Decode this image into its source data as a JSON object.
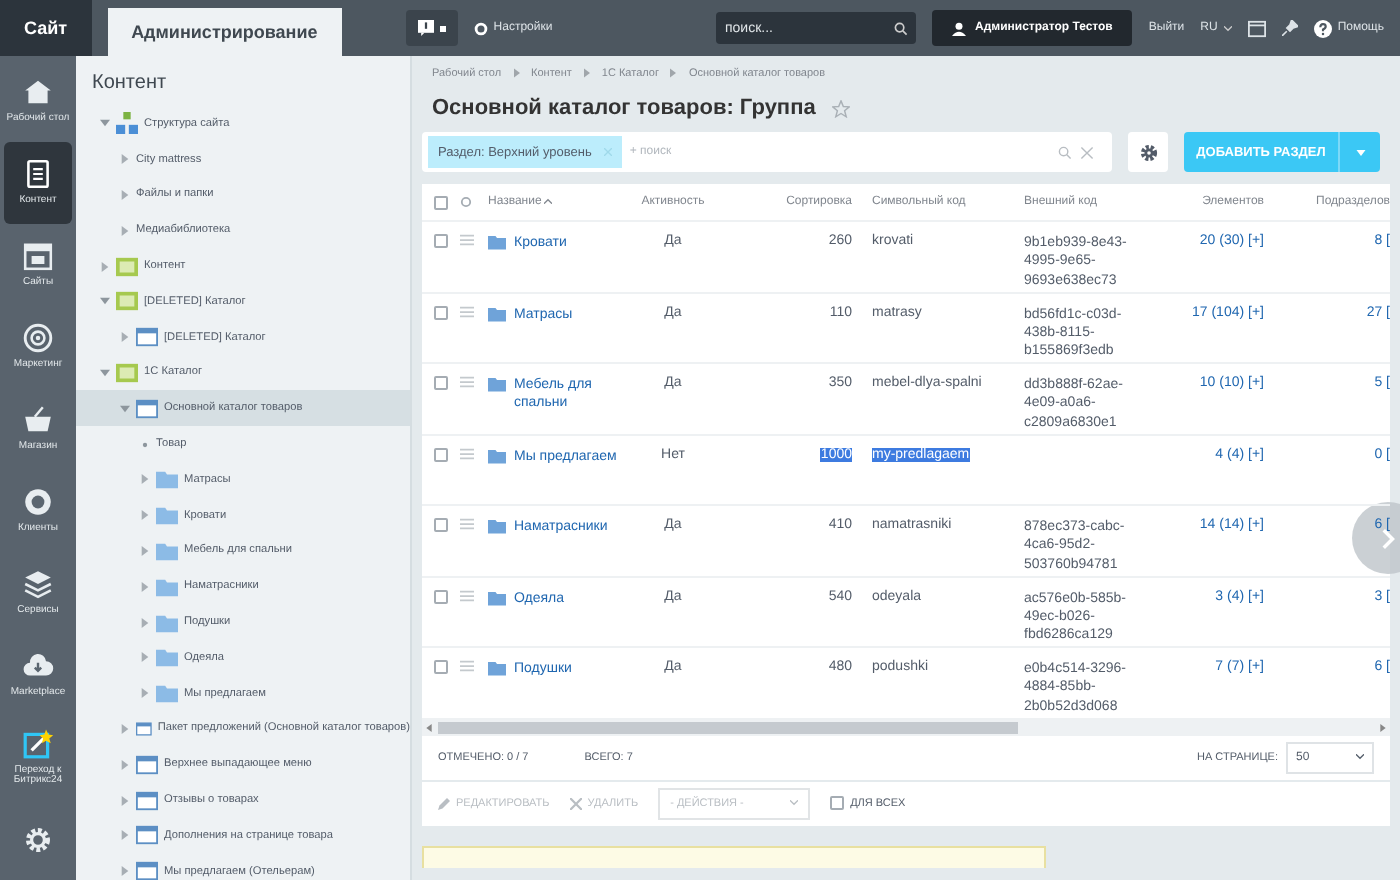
{
  "topbar": {
    "tabs": [
      {
        "label": "Сайт",
        "selected": false
      },
      {
        "label": "Администрирование",
        "selected": true
      }
    ],
    "settings": "Настройки",
    "search": {
      "placeholder": "поиск..."
    },
    "user": "Администратор Тестов",
    "logout": "Выйти",
    "language": "RU",
    "help": "Помощь"
  },
  "rail": [
    {
      "label": "Рабочий стол",
      "kind": "home",
      "selected": false
    },
    {
      "label": "Контент",
      "kind": "document",
      "selected": true
    },
    {
      "label": "Сайты",
      "kind": "calendar",
      "selected": false
    },
    {
      "label": "Маркетинг",
      "kind": "target",
      "selected": false
    },
    {
      "label": "Магазин",
      "kind": "basket",
      "selected": false
    },
    {
      "label": "Клиенты",
      "kind": "clients",
      "selected": false
    },
    {
      "label": "Сервисы",
      "kind": "layers",
      "selected": false
    },
    {
      "label": "Marketplace",
      "kind": "cloud",
      "selected": false
    },
    {
      "label": "Переход к Битрикс24",
      "kind": "wand",
      "selected": false
    },
    {
      "kind": "gear",
      "selected": false
    }
  ],
  "sidebar": {
    "title": "Контент",
    "items": [
      {
        "label": "Структура сайта",
        "kind": "site",
        "expanded": true,
        "selected": false,
        "children": [
          {
            "label": "City mattress",
            "kind": "plain",
            "expanded": false,
            "selected": false
          },
          {
            "label": "Файлы и папки",
            "kind": "plain",
            "expanded": false,
            "selected": false
          },
          {
            "label": "Медиабиблиотека",
            "kind": "plain",
            "expanded": false,
            "selected": false
          }
        ]
      },
      {
        "label": "Контент",
        "kind": "type",
        "expanded": false,
        "selected": false
      },
      {
        "label": "[DELETED] Каталог",
        "kind": "type",
        "expanded": true,
        "selected": false,
        "children": [
          {
            "label": "[DELETED] Каталог",
            "kind": "block",
            "expanded": false,
            "selected": false
          }
        ]
      },
      {
        "label": "1С Каталог",
        "kind": "type",
        "expanded": true,
        "selected": false,
        "children": [
          {
            "label": "Основной каталог товаров",
            "kind": "block",
            "expanded": true,
            "selected": true,
            "children": [
              {
                "label": "Товар",
                "kind": "bullet",
                "expanded": false,
                "selected": false
              },
              {
                "label": "Матрасы",
                "kind": "folder",
                "expanded": false,
                "selected": false
              },
              {
                "label": "Кровати",
                "kind": "folder",
                "expanded": false,
                "selected": false
              },
              {
                "label": "Мебель для спальни",
                "kind": "folder",
                "expanded": false,
                "selected": false
              },
              {
                "label": "Наматрасники",
                "kind": "folder",
                "expanded": false,
                "selected": false
              },
              {
                "label": "Подушки",
                "kind": "folder",
                "expanded": false,
                "selected": false
              },
              {
                "label": "Одеяла",
                "kind": "folder",
                "expanded": false,
                "selected": false
              },
              {
                "label": "Мы предлагаем",
                "kind": "folder",
                "expanded": false,
                "selected": false
              }
            ]
          },
          {
            "label": "Пакет предложений (Основной каталог товаров)",
            "kind": "block",
            "expanded": false,
            "selected": false
          },
          {
            "label": "Верхнее выпадающее меню",
            "kind": "block",
            "expanded": false,
            "selected": false
          },
          {
            "label": "Отзывы о товарах",
            "kind": "block",
            "expanded": false,
            "selected": false
          },
          {
            "label": "Дополнения на странице товара",
            "kind": "block",
            "expanded": false,
            "selected": false
          },
          {
            "label": "Мы предлагаем (Отельерам)",
            "kind": "block",
            "expanded": false,
            "selected": false
          }
        ]
      }
    ]
  },
  "breadcrumbs": [
    "Рабочий стол",
    "Контент",
    "1С Каталог",
    "Основной каталог товаров"
  ],
  "title": "Основной каталог товаров: Группа",
  "filter": {
    "chip": "Раздел: Верхний уровень",
    "placeholder": "+ поиск"
  },
  "add_button": "ДОБАВИТЬ РАЗДЕЛ",
  "table": {
    "select_all_checked": false,
    "columns": [
      "Название",
      "Активность",
      "Сортировка",
      "Символьный код",
      "Внешний код",
      "Элементов",
      "Подразделов"
    ],
    "rows": [
      {
        "name": "Кровати",
        "active": "Да",
        "sort": "260",
        "code": "krovati",
        "external": "9b1eb939-8e43-4995-9e65-9693e638ec73",
        "elements": "20 (30) [+]",
        "subsections": "8 [",
        "text_selected": false,
        "checked": false
      },
      {
        "name": "Матрасы",
        "active": "Да",
        "sort": "110",
        "code": "matrasy",
        "external": "bd56fd1c-c03d-438b-8115-b155869f3edb",
        "elements": "17 (104) [+]",
        "subsections": "27 [",
        "text_selected": false,
        "checked": false
      },
      {
        "name": "Мебель для спальни",
        "active": "Да",
        "sort": "350",
        "code": "mebel-dlya-spalni",
        "external": "dd3b888f-62ae-4e09-a0a6-c2809a6830e1",
        "elements": "10 (10) [+]",
        "subsections": "5 [",
        "text_selected": false,
        "checked": false
      },
      {
        "name": "Мы предлагаем",
        "active": "Нет",
        "sort": "1000",
        "code": "my-predlagaem",
        "elements": "4 (4) [+]",
        "subsections": "0 [",
        "text_selected": true,
        "checked": false
      },
      {
        "name": "Наматрасники",
        "active": "Да",
        "sort": "410",
        "code": "namatrasniki",
        "external": "878ec373-cabc-4ca6-95d2-503760b94781",
        "elements": "14 (14) [+]",
        "subsections": "6 [",
        "text_selected": false,
        "checked": false
      },
      {
        "name": "Одеяла",
        "active": "Да",
        "sort": "540",
        "code": "odeyala",
        "external": "ac576e0b-585b-49ec-b026-fbd6286ca129",
        "elements": "3 (4) [+]",
        "subsections": "3 [",
        "text_selected": false,
        "checked": false
      },
      {
        "name": "Подушки",
        "active": "Да",
        "sort": "480",
        "code": "podushki",
        "external": "e0b4c514-3296-4884-85bb-2b0b52d3d068",
        "elements": "7 (7) [+]",
        "subsections": "6 [",
        "text_selected": false,
        "checked": false
      }
    ]
  },
  "footer": {
    "checked": "ОТМЕЧЕНО: 0 / 7",
    "total": "ВСЕГО: 7",
    "per_page_label": "НА СТРАНИЦЕ:",
    "per_page": "50"
  },
  "actions": {
    "edit": {
      "label": "РЕДАКТИРОВАТЬ",
      "disabled": true
    },
    "delete": {
      "label": "УДАЛИТЬ",
      "disabled": true
    },
    "select": "- ДЕЙСТВИЯ -",
    "for_all": {
      "label": "ДЛЯ ВСЕХ",
      "checked": false
    }
  }
}
